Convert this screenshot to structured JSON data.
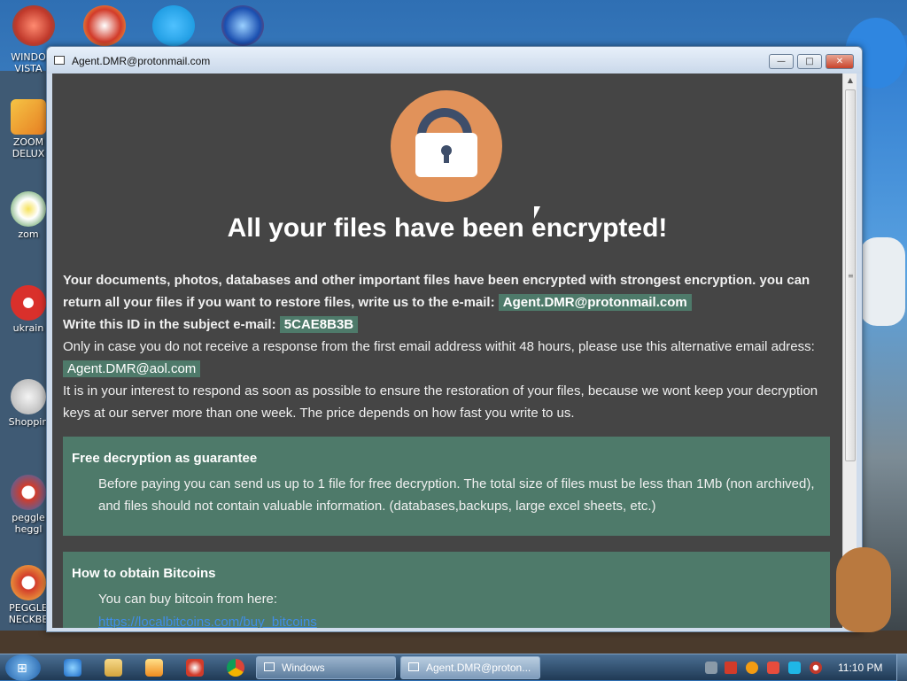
{
  "desktop": {
    "icons": [
      {
        "label": "WINDO\nVISTA"
      },
      {
        "label": "ZOOM\nDELUX"
      },
      {
        "label": "zom"
      },
      {
        "label": "ukrain"
      },
      {
        "label": "Shoppin"
      },
      {
        "label": "peggle\nheggl"
      },
      {
        "label": "PEGGLE\nNECKBE"
      }
    ]
  },
  "window": {
    "title": "Agent.DMR@protonmail.com",
    "buttons": {
      "minimize": "—",
      "maximize": "□",
      "close": "✕"
    }
  },
  "note": {
    "headline": "All your files have been encrypted!",
    "intro": "Your documents, photos, databases and other important files have been encrypted with strongest encryption. you can return all your files if you want to restore files, write us to the e-mail:",
    "email_primary": "Agent.DMR@protonmail.com",
    "id_label": "Write this ID in the subject e-mail:",
    "id_value": "5CAE8B3B",
    "alt_text": "Only in case you do not receive a response from the first email address withit 48 hours, please use this alternative email adress:",
    "email_alt": "Agent.DMR@aol.com",
    "interest_text": "It is in your interest to respond as soon as possible to ensure the restoration of your files, because we wont keep your decryption keys at our server more than one week. The price depends on how fast you write to us.",
    "free_title": "Free decryption as guarantee",
    "free_text": "Before paying you can send us up to 1 file for free decryption. The total size of files must be less than 1Mb (non archived), and files should not contain valuable information. (databases,backups, large excel sheets, etc.)",
    "bitcoin_title": "How to obtain Bitcoins",
    "bitcoin_text": "You can buy bitcoin from here:",
    "bitcoin_link": "https://localbitcoins.com/buy_bitcoins"
  },
  "taskbar": {
    "tasks": [
      {
        "label": "Windows"
      },
      {
        "label": "Agent.DMR@proton..."
      }
    ],
    "clock": "11:10 PM"
  },
  "colors": {
    "note_bg": "#454545",
    "highlight": "#4e7a6a",
    "lock_circle": "#e1925a",
    "link": "#3f8ee8"
  }
}
